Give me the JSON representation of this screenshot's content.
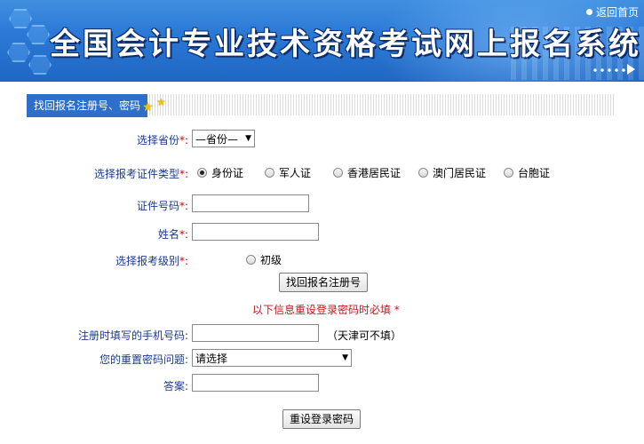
{
  "header": {
    "title": "全国会计专业技术资格考试网上报名系统",
    "home_link": "返回首页"
  },
  "section": {
    "tab_label": "找回报名注册号、密码"
  },
  "form": {
    "province": {
      "label": "选择省份",
      "required_mark": "*:",
      "selected": "—省份—"
    },
    "id_type": {
      "label": "选择报考证件类型",
      "required_mark": "*:",
      "options": [
        "身份证",
        "军人证",
        "香港居民证",
        "澳门居民证",
        "台胞证"
      ],
      "selected_index": 0
    },
    "id_number": {
      "label": "证件号码",
      "required_mark": "*:",
      "value": ""
    },
    "name": {
      "label": "姓名",
      "required_mark": "*:",
      "value": ""
    },
    "level": {
      "label": "选择报考级别",
      "required_mark": "*:",
      "option": "初级"
    },
    "find_button": "找回报名注册号",
    "notice": "以下信息重设登录密码时必填 *",
    "phone": {
      "label": "注册时填写的手机号码:",
      "value": "",
      "hint": "（天津可不填）"
    },
    "question": {
      "label": "您的重置密码问题:",
      "selected": "请选择"
    },
    "answer": {
      "label": "答案:",
      "value": ""
    },
    "reset_button": "重设登录密码"
  },
  "colors": {
    "banner_blue": "#2b79d6",
    "tab_blue": "#2f6fc9",
    "label_blue": "#1a3b8c",
    "required_red": "#d40000",
    "notice_red": "#c8141e"
  }
}
